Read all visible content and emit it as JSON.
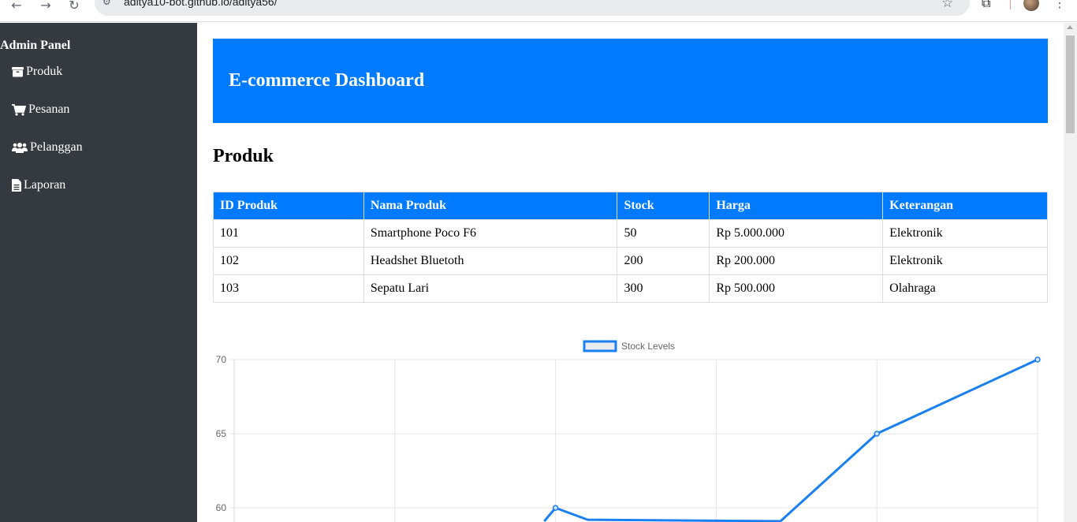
{
  "browser": {
    "url": "aditya10-bot.github.io/aditya56/"
  },
  "sidebar": {
    "title": "Admin Panel",
    "items": [
      {
        "label": "Produk",
        "icon": "box-icon"
      },
      {
        "label": "Pesanan",
        "icon": "cart-icon"
      },
      {
        "label": "Pelanggan",
        "icon": "users-icon"
      },
      {
        "label": "Laporan",
        "icon": "file-icon"
      }
    ]
  },
  "header": {
    "title": "E-commerce Dashboard"
  },
  "main": {
    "section_title": "Produk",
    "table": {
      "columns": [
        "ID Produk",
        "Nama Produk",
        "Stock",
        "Harga",
        "Keterangan"
      ],
      "rows": [
        [
          "101",
          "Smartphone Poco F6",
          "50",
          "Rp 5.000.000",
          "Elektronik"
        ],
        [
          "102",
          "Headshet Bluetoth",
          "200",
          "Rp 200.000",
          "Elektronik"
        ],
        [
          "103",
          "Sepatu Lari",
          "300",
          "Rp 500.000",
          "Olahraga"
        ]
      ]
    }
  },
  "colors": {
    "sidebar_bg": "#343a40",
    "accent": "#007bff",
    "line": "#1a7ff0"
  },
  "chart_data": {
    "type": "line",
    "title": "",
    "series": [
      {
        "name": "Stock Levels",
        "values": [
          null,
          null,
          60,
          null,
          65,
          70
        ]
      }
    ],
    "x": [
      0,
      1,
      2,
      3,
      4,
      5
    ],
    "visible_segment": [
      [
        1.93,
        59.1
      ],
      [
        2.0,
        60
      ],
      [
        2.2,
        59.2
      ],
      [
        3.4,
        59.1
      ],
      [
        4.0,
        65
      ],
      [
        5.0,
        70
      ]
    ],
    "yticks": [
      60,
      65,
      70
    ],
    "ylim": [
      59,
      70
    ],
    "grid": true,
    "legend": "top-center"
  }
}
